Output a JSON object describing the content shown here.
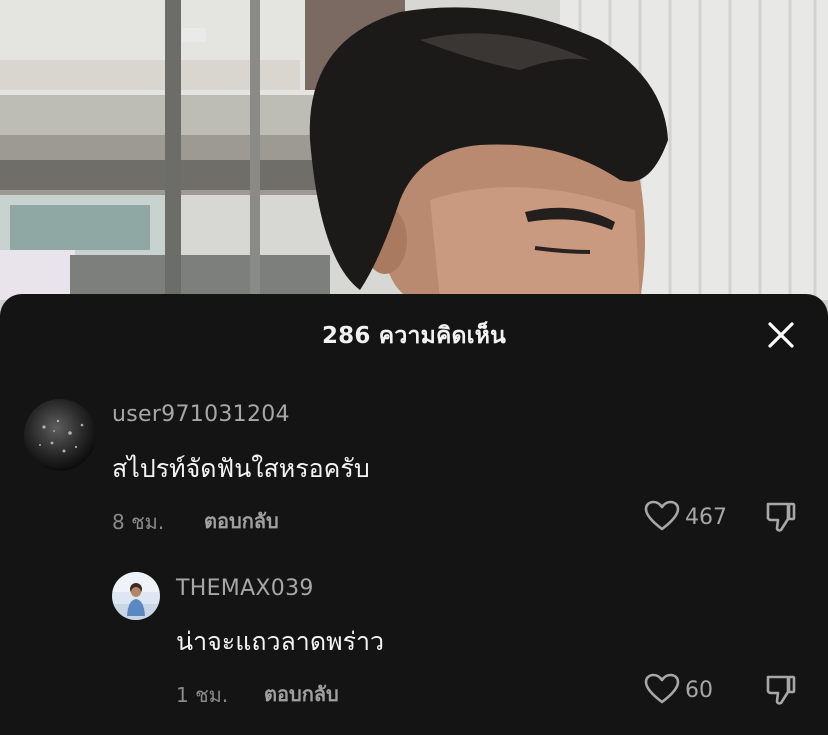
{
  "comments_sheet": {
    "title": "286 ความคิดเห็น",
    "close_icon": "close-icon"
  },
  "comments": [
    {
      "username": "user971031204",
      "text": "สไปรท์จัดฟันใสหรอครับ",
      "time": "8 ชม.",
      "reply_label": "ตอบกลับ",
      "like_count": "467",
      "avatar": "avatar-image"
    }
  ],
  "replies": [
    {
      "username": "THEMAX039",
      "text": "น่าจะแถวลาดพร่าว",
      "time": "1 ชม.",
      "reply_label": "ตอบกลับ",
      "like_count": "60",
      "avatar": "avatar-image"
    }
  ],
  "colors": {
    "sheet_background": "#141414",
    "primary_text": "#f4f4f4",
    "secondary_text": "#a7a7a7"
  }
}
